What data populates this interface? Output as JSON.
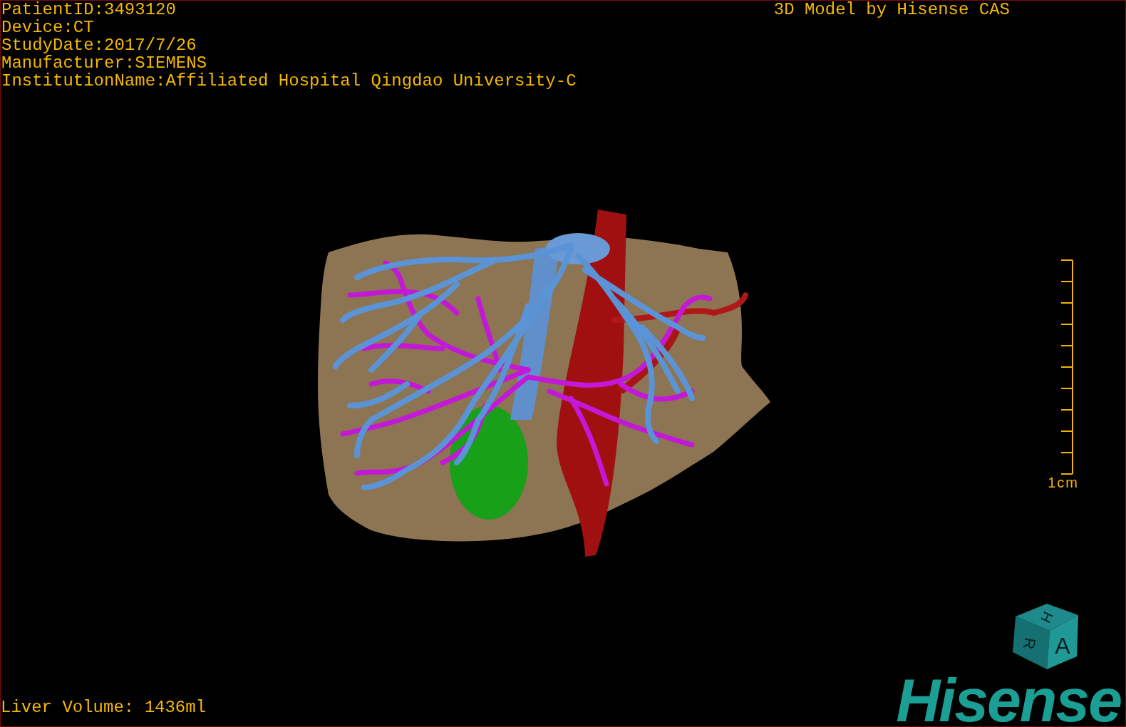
{
  "header": {
    "info_lines": [
      "PatientID:3493120",
      "Device:CT",
      "StudyDate:2017/7/26",
      "Manufacturer:SIEMENS",
      "InstitutionName:Affiliated Hospital Qingdao University-C"
    ],
    "title": "3D Model by Hisense CAS"
  },
  "scale_bar": {
    "label": "1cm"
  },
  "orientation_cube": {
    "faces": [
      "H",
      "R",
      "A"
    ]
  },
  "footer": {
    "liver_volume": "Liver Volume: 1436ml",
    "logo": "Hisense"
  }
}
